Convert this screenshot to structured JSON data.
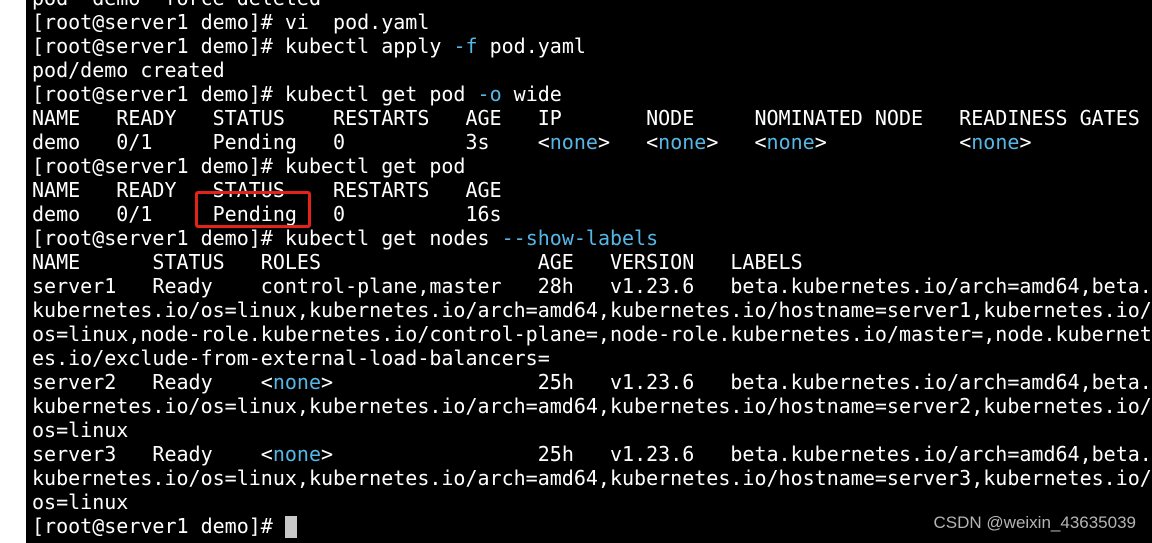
{
  "terminal": {
    "lines": [
      {
        "segments": [
          {
            "text": "pod \"demo\" force deleted"
          }
        ]
      },
      {
        "segments": [
          {
            "text": "[root@server1 demo]# vi  pod.yaml"
          }
        ]
      },
      {
        "segments": [
          {
            "text": "[root@server1 demo]# kubectl apply "
          },
          {
            "text": "-f",
            "style": "flag"
          },
          {
            "text": " pod.yaml"
          }
        ]
      },
      {
        "segments": [
          {
            "text": "pod/demo created"
          }
        ]
      },
      {
        "segments": [
          {
            "text": "[root@server1 demo]# kubectl get pod "
          },
          {
            "text": "-o",
            "style": "flag"
          },
          {
            "text": " wide"
          }
        ]
      },
      {
        "segments": [
          {
            "text": "NAME   READY   STATUS    RESTARTS   AGE   IP       NODE     NOMINATED NODE   READINESS GATES"
          }
        ]
      },
      {
        "segments": [
          {
            "text": "demo   0/1     Pending   0          3s    <"
          },
          {
            "text": "none",
            "style": "none"
          },
          {
            "text": ">   <"
          },
          {
            "text": "none",
            "style": "none"
          },
          {
            "text": ">   <"
          },
          {
            "text": "none",
            "style": "none"
          },
          {
            "text": ">           <"
          },
          {
            "text": "none",
            "style": "none"
          },
          {
            "text": ">"
          }
        ]
      },
      {
        "segments": [
          {
            "text": "[root@server1 demo]# kubectl get pod"
          }
        ]
      },
      {
        "segments": [
          {
            "text": "NAME   READY   STATUS    RESTARTS   AGE"
          }
        ]
      },
      {
        "segments": [
          {
            "text": "demo   0/1     Pending   0          16s"
          }
        ]
      },
      {
        "segments": [
          {
            "text": "[root@server1 demo]# kubectl get nodes "
          },
          {
            "text": "--show-labels",
            "style": "flag"
          }
        ]
      },
      {
        "segments": [
          {
            "text": "NAME      STATUS   ROLES                  AGE   VERSION   LABELS"
          }
        ]
      },
      {
        "segments": [
          {
            "text": "server1   Ready    control-plane,master   28h   v1.23.6   beta.kubernetes.io/arch=amd64,beta."
          }
        ]
      },
      {
        "segments": [
          {
            "text": "kubernetes.io/os=linux,kubernetes.io/arch=amd64,kubernetes.io/hostname=server1,kubernetes.io/"
          }
        ]
      },
      {
        "segments": [
          {
            "text": "os=linux,node-role.kubernetes.io/control-plane=,node-role.kubernetes.io/master=,node.kubernet"
          }
        ]
      },
      {
        "segments": [
          {
            "text": "es.io/exclude-from-external-load-balancers="
          }
        ]
      },
      {
        "segments": [
          {
            "text": "server2   Ready    <"
          },
          {
            "text": "none",
            "style": "none"
          },
          {
            "text": ">                 25h   v1.23.6   beta.kubernetes.io/arch=amd64,beta."
          }
        ]
      },
      {
        "segments": [
          {
            "text": "kubernetes.io/os=linux,kubernetes.io/arch=amd64,kubernetes.io/hostname=server2,kubernetes.io/"
          }
        ]
      },
      {
        "segments": [
          {
            "text": "os=linux"
          }
        ]
      },
      {
        "segments": [
          {
            "text": "server3   Ready    <"
          },
          {
            "text": "none",
            "style": "none"
          },
          {
            "text": ">                 25h   v1.23.6   beta.kubernetes.io/arch=amd64,beta."
          }
        ]
      },
      {
        "segments": [
          {
            "text": "kubernetes.io/os=linux,kubernetes.io/arch=amd64,kubernetes.io/hostname=server3,kubernetes.io/"
          }
        ]
      },
      {
        "segments": [
          {
            "text": "os=linux"
          }
        ]
      }
    ],
    "prompt": "[root@server1 demo]# ",
    "colors": {
      "background": "#000000",
      "foreground": "#ffffff",
      "flag": "#56b6e6",
      "highlight_box": "#e32219",
      "cursor": "#c8c8c8"
    }
  },
  "watermark": "CSDN @weixin_43635039"
}
